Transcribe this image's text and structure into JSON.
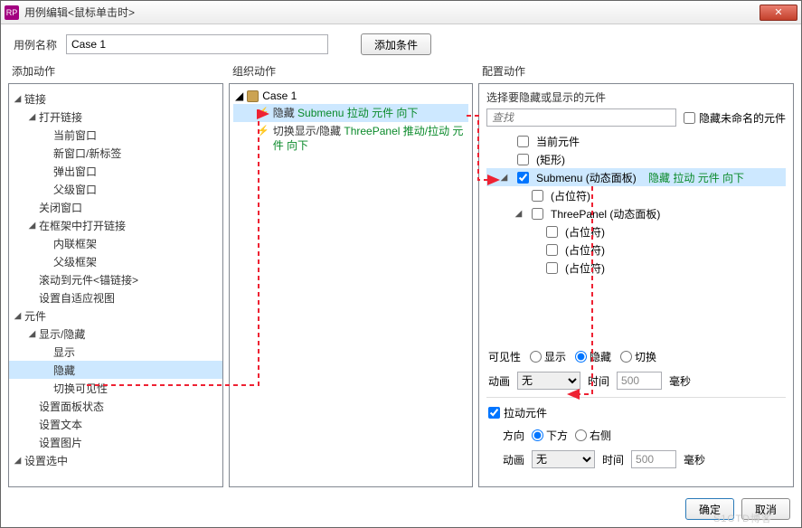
{
  "title": "用例编辑<鼠标单击时>",
  "close_glyph": "✕",
  "name_row": {
    "label": "用例名称",
    "value": "Case 1",
    "add_condition": "添加条件"
  },
  "columns": {
    "add": "添加动作",
    "org": "组织动作",
    "cfg": "配置动作"
  },
  "add_actions": {
    "links_hdr": "链接",
    "open_link": "打开链接",
    "cur_win": "当前窗口",
    "new_win": "新窗口/新标签",
    "popup": "弹出窗口",
    "parent_win": "父级窗口",
    "close_win": "关闭窗口",
    "open_in_frame": "在框架中打开链接",
    "inline_frame": "内联框架",
    "parent_frame": "父级框架",
    "scroll_to": "滚动到元件<锚链接>",
    "set_adaptive": "设置自适应视图",
    "widgets_hdr": "元件",
    "show_hide": "显示/隐藏",
    "show": "显示",
    "hide": "隐藏",
    "toggle_vis": "切换可见性",
    "set_panel": "设置面板状态",
    "set_text": "设置文本",
    "set_image": "设置图片",
    "set_sel": "设置选中"
  },
  "org": {
    "case": "Case 1",
    "a1_pre": "隐藏 ",
    "a1_grn": "Submenu 拉动 元件 向下",
    "a2_pre": "切换显示/隐藏 ",
    "a2_grn": "ThreePanel 推动/拉动 元件 向下"
  },
  "cfg": {
    "hdr": "选择要隐藏或显示的元件",
    "search_ph": "查找",
    "hide_unnamed": "隐藏未命名的元件",
    "items": {
      "current": "当前元件",
      "rect": "(矩形)",
      "submenu_name": "Submenu (动态面板)",
      "submenu_tail": "隐藏 拉动 元件 向下",
      "placeholder": "(占位符)",
      "threepanel": "ThreePanel (动态面板)"
    },
    "vis_label": "可见性",
    "vis_show": "显示",
    "vis_hide": "隐藏",
    "vis_toggle": "切换",
    "anim_label": "动画",
    "anim_none": "无",
    "time_label": "时间",
    "time_val": "500",
    "ms": "毫秒",
    "pull": "拉动元件",
    "dir_label": "方向",
    "dir_down": "下方",
    "dir_right": "右侧"
  },
  "footer": {
    "ok": "确定",
    "cancel": "取消"
  }
}
